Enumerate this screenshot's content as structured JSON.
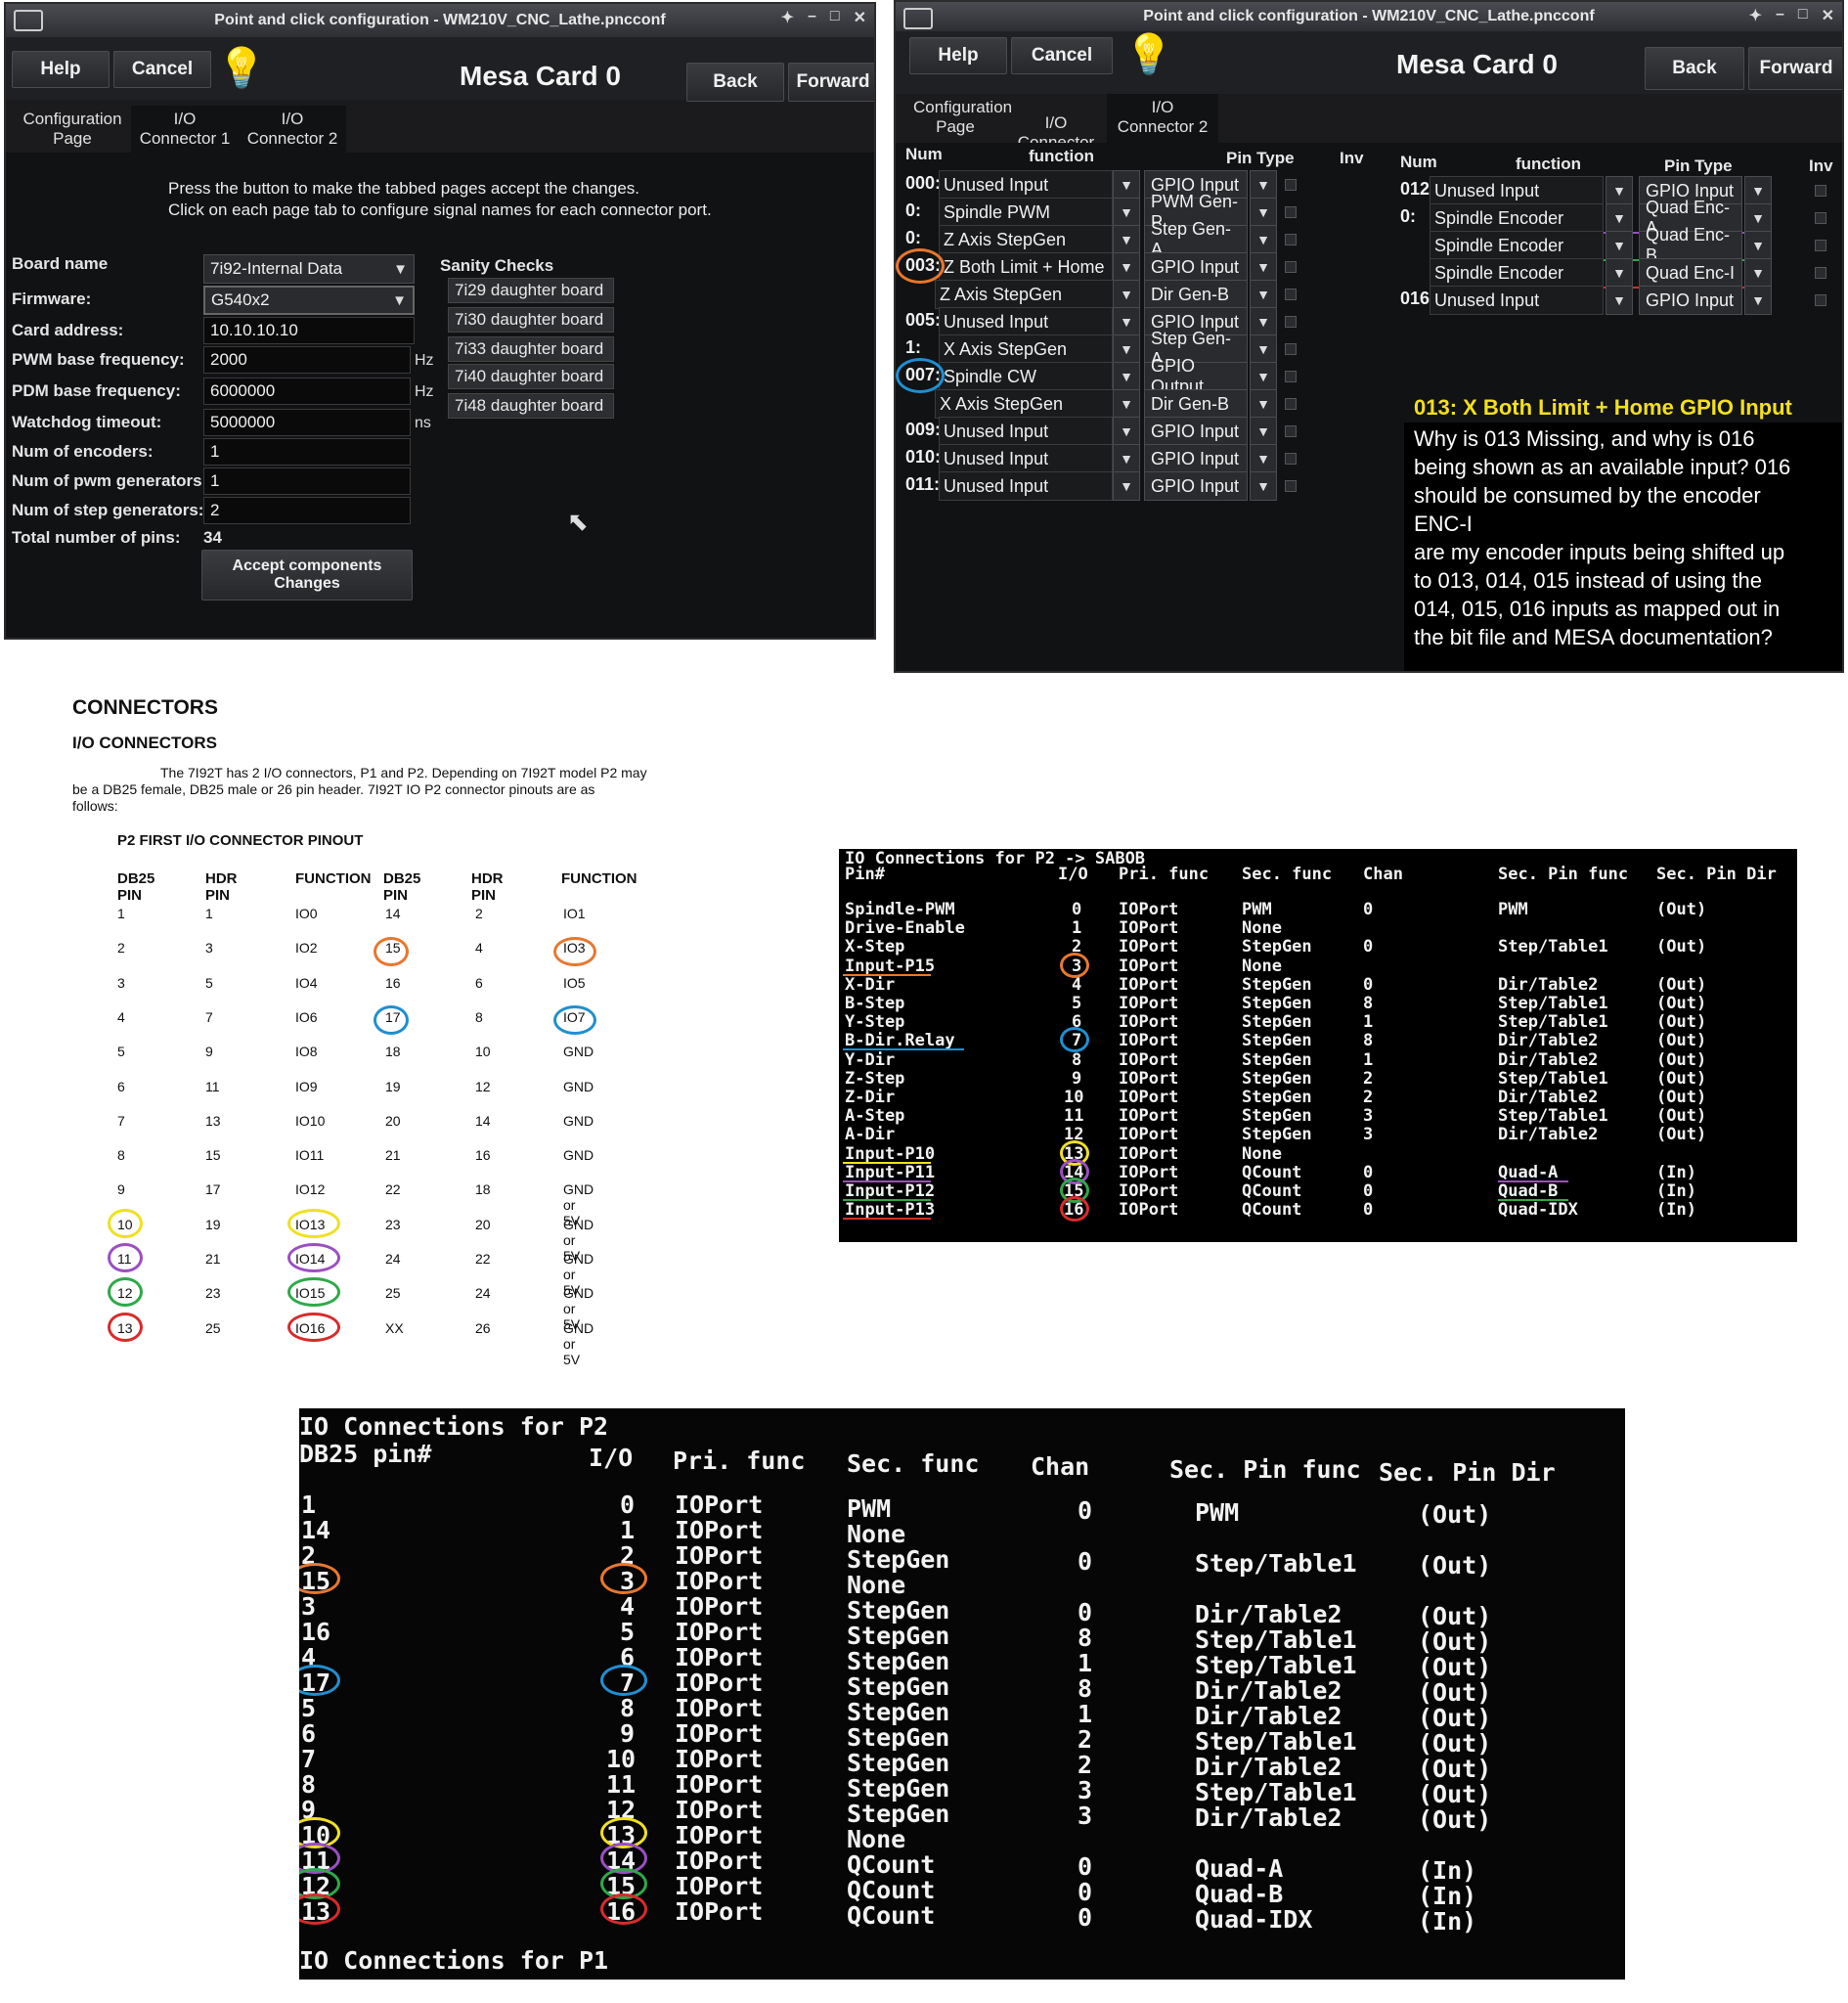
{
  "left_window": {
    "title": "Point and click configuration - WM210V_CNC_Lathe.pncconf",
    "help": "Help",
    "cancel": "Cancel",
    "card": "Mesa Card 0",
    "back": "Back",
    "forward": "Forward",
    "tabs": [
      "Configuration Page",
      "I/O Connector 1",
      "I/O Connector 2"
    ],
    "instructions": [
      "Press the button to make the tabbed pages accept the changes.",
      "Click on each page tab to configure signal names for each connector port."
    ],
    "fields": [
      {
        "label": "Board name",
        "value": "7i92-Internal Data"
      },
      {
        "label": "Firmware:",
        "value": "G540x2"
      },
      {
        "label": "Card address:",
        "value": "10.10.10.10"
      },
      {
        "label": "PWM base frequency:",
        "value": "2000",
        "unit": "Hz"
      },
      {
        "label": "PDM base frequency:",
        "value": "6000000",
        "unit": "Hz"
      },
      {
        "label": "Watchdog timeout:",
        "value": "5000000",
        "unit": "ns"
      },
      {
        "label": "Num of encoders:",
        "value": "1"
      },
      {
        "label": "Num of pwm generators:",
        "value": "1"
      },
      {
        "label": "Num of step generators:",
        "value": "2"
      },
      {
        "label": "Total number of pins:",
        "value": "34"
      }
    ],
    "sanity_title": "Sanity Checks",
    "sanity": [
      "7i29 daughter board",
      "7i30 daughter board",
      "7i33 daughter board",
      "7i40 daughter board",
      "7i48 daughter board"
    ],
    "accept": [
      "Accept components",
      "Changes"
    ]
  },
  "right_window": {
    "title": "Point and click configuration - WM210V_CNC_Lathe.pncconf",
    "help": "Help",
    "cancel": "Cancel",
    "card": "Mesa Card 0",
    "back": "Back",
    "forward": "Forward",
    "tabs": [
      "Configuration Page",
      "I/O Connector 1",
      "I/O Connector 2"
    ],
    "headers": [
      "Num",
      "function",
      "Pin Type",
      "Inv"
    ],
    "left_rows": [
      {
        "num": "000:",
        "func": "Unused Input",
        "pin": "GPIO Input"
      },
      {
        "num": "0:",
        "func": "Spindle PWM",
        "pin": "PWM Gen-P"
      },
      {
        "num": "0:",
        "func": "Z Axis StepGen",
        "pin": "Step Gen-A"
      },
      {
        "num": "003:",
        "func": "Z Both Limit + Home",
        "pin": "GPIO Input"
      },
      {
        "num": "",
        "func": "Z Axis StepGen",
        "pin": "Dir Gen-B"
      },
      {
        "num": "005:",
        "func": "Unused Input",
        "pin": "GPIO Input"
      },
      {
        "num": "1:",
        "func": "X Axis StepGen",
        "pin": "Step Gen-A"
      },
      {
        "num": "007:",
        "func": "Spindle CW",
        "pin": "GPIO Output"
      },
      {
        "num": "",
        "func": "X Axis StepGen",
        "pin": "Dir Gen-B"
      },
      {
        "num": "009:",
        "func": "Unused Input",
        "pin": "GPIO Input"
      },
      {
        "num": "010:",
        "func": "Unused Input",
        "pin": "GPIO Input"
      },
      {
        "num": "011:",
        "func": "Unused Input",
        "pin": "GPIO Input"
      }
    ],
    "right_rows": [
      {
        "num": "012:",
        "func": "Unused Input",
        "pin": "GPIO Input"
      },
      {
        "num": "0:",
        "func": "Spindle Encoder",
        "pin": "Quad Enc-A"
      },
      {
        "num": "",
        "func": "Spindle Encoder",
        "pin": "Quad Enc-B"
      },
      {
        "num": "",
        "func": "Spindle Encoder",
        "pin": "Quad Enc-I"
      },
      {
        "num": "016:",
        "func": "Unused Input",
        "pin": "GPIO Input"
      }
    ],
    "annotation_title": "013: X Both Limit + Home    GPIO Input",
    "annotation_lines": [
      "Why is 013 Missing, and why is 016",
      "being shown as an available input? 016",
      "should be consumed by the encoder",
      "ENC-I",
      "are my encoder inputs being shifted up",
      "to 013, 014, 015 instead of using the",
      "014, 015, 016 inputs as mapped out in",
      "the bit file and MESA documentation?"
    ]
  },
  "doc": {
    "heading": "CONNECTORS",
    "subheading": "I/O CONNECTORS",
    "para": [
      "The 7I92T has 2 I/O connectors, P1 and P2.  Depending on 7I92T model P2 may",
      "be a DB25 female, DB25 male or 26 pin header. 7I92T IO P2 connector pinouts are as",
      "follows:"
    ],
    "table_title": "P2 FIRST I/O CONNECTOR PINOUT",
    "columns": [
      "DB25 PIN",
      "HDR PIN",
      "FUNCTION",
      "DB25 PIN",
      "HDR PIN",
      "FUNCTION"
    ],
    "rows": [
      [
        "1",
        "1",
        "IO0",
        "14",
        "2",
        "IO1"
      ],
      [
        "2",
        "3",
        "IO2",
        "15",
        "4",
        "IO3"
      ],
      [
        "3",
        "5",
        "IO4",
        "16",
        "6",
        "IO5"
      ],
      [
        "4",
        "7",
        "IO6",
        "17",
        "8",
        "IO7"
      ],
      [
        "5",
        "9",
        "IO8",
        "18",
        "10",
        "GND"
      ],
      [
        "6",
        "11",
        "IO9",
        "19",
        "12",
        "GND"
      ],
      [
        "7",
        "13",
        "IO10",
        "20",
        "14",
        "GND"
      ],
      [
        "8",
        "15",
        "IO11",
        "21",
        "16",
        "GND"
      ],
      [
        "9",
        "17",
        "IO12",
        "22",
        "18",
        "GND or 5V"
      ],
      [
        "10",
        "19",
        "IO13",
        "23",
        "20",
        "GND or 5V"
      ],
      [
        "11",
        "21",
        "IO14",
        "24",
        "22",
        "GND or 5V"
      ],
      [
        "12",
        "23",
        "IO15",
        "25",
        "24",
        "GND or 5V"
      ],
      [
        "13",
        "25",
        "IO16",
        "XX",
        "26",
        "GND or 5V"
      ]
    ]
  },
  "term1": {
    "title": "IO Connections for P2 -> SABOB",
    "headers": [
      "Pin#",
      "I/O",
      "Pri. func",
      "Sec. func",
      "Chan",
      "Sec. Pin func",
      "Sec. Pin Dir"
    ],
    "rows": [
      [
        "Spindle-PWM",
        "0",
        "IOPort",
        "PWM",
        "0",
        "PWM",
        "(Out)"
      ],
      [
        "Drive-Enable",
        "1",
        "IOPort",
        "None",
        "",
        "",
        ""
      ],
      [
        "X-Step",
        "2",
        "IOPort",
        "StepGen",
        "0",
        "Step/Table1",
        "(Out)"
      ],
      [
        "Input-P15",
        "3",
        "IOPort",
        "None",
        "",
        "",
        ""
      ],
      [
        "X-Dir",
        "4",
        "IOPort",
        "StepGen",
        "0",
        "Dir/Table2",
        "(Out)"
      ],
      [
        "B-Step",
        "5",
        "IOPort",
        "StepGen",
        "8",
        "Step/Table1",
        "(Out)"
      ],
      [
        "Y-Step",
        "6",
        "IOPort",
        "StepGen",
        "1",
        "Step/Table1",
        "(Out)"
      ],
      [
        "B-Dir.Relay",
        "7",
        "IOPort",
        "StepGen",
        "8",
        "Dir/Table2",
        "(Out)"
      ],
      [
        "Y-Dir",
        "8",
        "IOPort",
        "StepGen",
        "1",
        "Dir/Table2",
        "(Out)"
      ],
      [
        "Z-Step",
        "9",
        "IOPort",
        "StepGen",
        "2",
        "Step/Table1",
        "(Out)"
      ],
      [
        "Z-Dir",
        "10",
        "IOPort",
        "StepGen",
        "2",
        "Dir/Table2",
        "(Out)"
      ],
      [
        "A-Step",
        "11",
        "IOPort",
        "StepGen",
        "3",
        "Step/Table1",
        "(Out)"
      ],
      [
        "A-Dir",
        "12",
        "IOPort",
        "StepGen",
        "3",
        "Dir/Table2",
        "(Out)"
      ],
      [
        "Input-P10",
        "13",
        "IOPort",
        "None",
        "",
        "",
        ""
      ],
      [
        "Input-P11",
        "14",
        "IOPort",
        "QCount",
        "0",
        "Quad-A",
        "(In)"
      ],
      [
        "Input-P12",
        "15",
        "IOPort",
        "QCount",
        "0",
        "Quad-B",
        "(In)"
      ],
      [
        "Input-P13",
        "16",
        "IOPort",
        "QCount",
        "0",
        "Quad-IDX",
        "(In)"
      ]
    ]
  },
  "term2": {
    "title": "IO Connections for P2",
    "pinhdr": "DB25 pin#",
    "headers": [
      "I/O",
      "Pri. func",
      "Sec. func",
      "Chan",
      "Sec. Pin func",
      "Sec. Pin Dir"
    ],
    "rows": [
      [
        "1",
        "0",
        "IOPort",
        "PWM",
        "0",
        "PWM",
        "(Out)"
      ],
      [
        "14",
        "1",
        "IOPort",
        "None",
        "",
        "",
        ""
      ],
      [
        "2",
        "2",
        "IOPort",
        "StepGen",
        "0",
        "Step/Table1",
        "(Out)"
      ],
      [
        "15",
        "3",
        "IOPort",
        "None",
        "",
        "",
        ""
      ],
      [
        "3",
        "4",
        "IOPort",
        "StepGen",
        "0",
        "Dir/Table2",
        "(Out)"
      ],
      [
        "16",
        "5",
        "IOPort",
        "StepGen",
        "8",
        "Step/Table1",
        "(Out)"
      ],
      [
        "4",
        "6",
        "IOPort",
        "StepGen",
        "1",
        "Step/Table1",
        "(Out)"
      ],
      [
        "17",
        "7",
        "IOPort",
        "StepGen",
        "8",
        "Dir/Table2",
        "(Out)"
      ],
      [
        "5",
        "8",
        "IOPort",
        "StepGen",
        "1",
        "Dir/Table2",
        "(Out)"
      ],
      [
        "6",
        "9",
        "IOPort",
        "StepGen",
        "2",
        "Step/Table1",
        "(Out)"
      ],
      [
        "7",
        "10",
        "IOPort",
        "StepGen",
        "2",
        "Dir/Table2",
        "(Out)"
      ],
      [
        "8",
        "11",
        "IOPort",
        "StepGen",
        "3",
        "Step/Table1",
        "(Out)"
      ],
      [
        "9",
        "12",
        "IOPort",
        "StepGen",
        "3",
        "Dir/Table2",
        "(Out)"
      ],
      [
        "10",
        "13",
        "IOPort",
        "None",
        "",
        "",
        ""
      ],
      [
        "11",
        "14",
        "IOPort",
        "QCount",
        "0",
        "Quad-A",
        "(In)"
      ],
      [
        "12",
        "15",
        "IOPort",
        "QCount",
        "0",
        "Quad-B",
        "(In)"
      ],
      [
        "13",
        "16",
        "IOPort",
        "QCount",
        "0",
        "Quad-IDX",
        "(In)"
      ]
    ],
    "footer": "IO Connections for P1"
  },
  "colors": {
    "orange": "#e8772e",
    "blue": "#1f8fd0",
    "yellow": "#f0e020",
    "purple": "#9b4fc0",
    "green": "#2fa84a",
    "red": "#d82b2b"
  }
}
